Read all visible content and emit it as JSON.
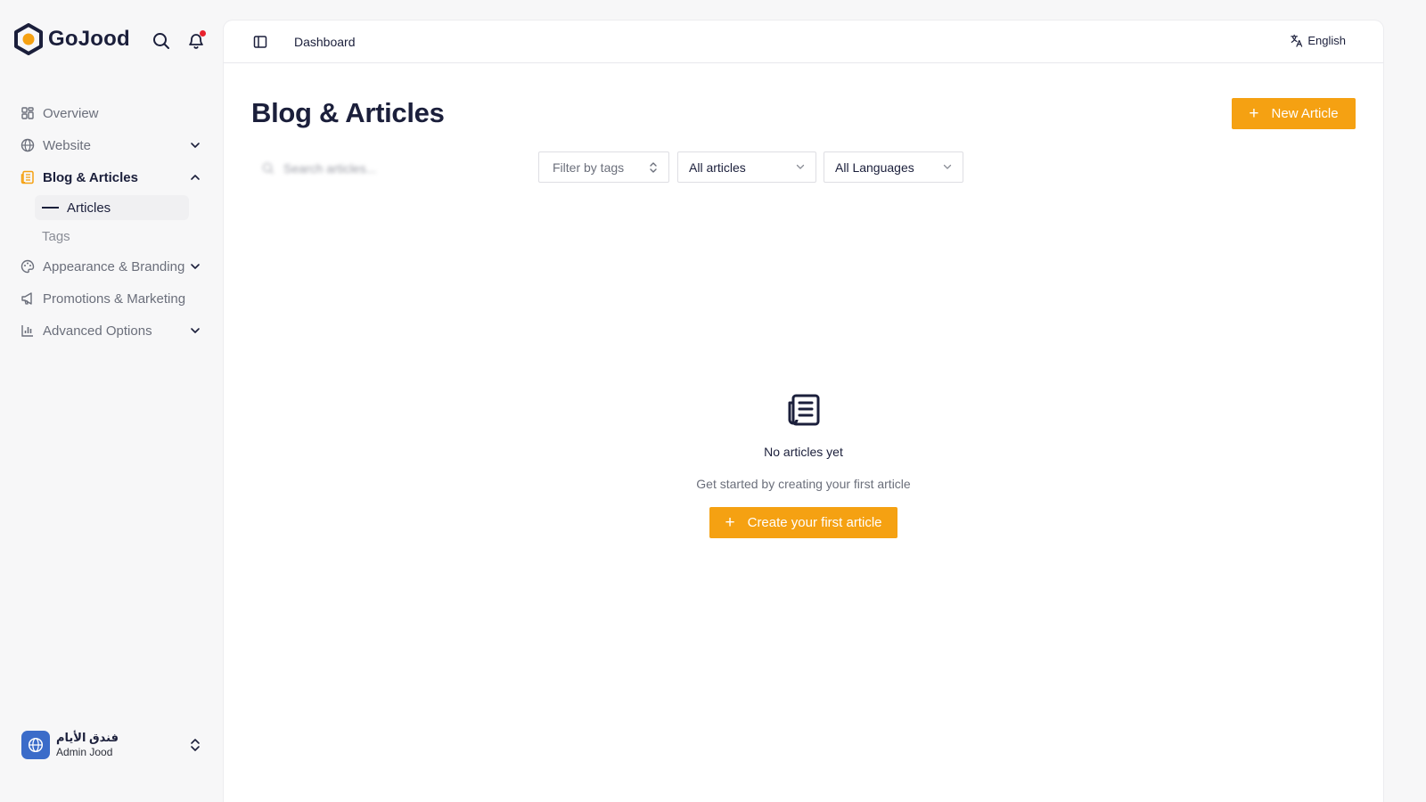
{
  "brand": {
    "name": "GoJood",
    "accent": "#f5a112",
    "navy": "#1b1f3b"
  },
  "sidebar": {
    "items": [
      {
        "label": "Overview",
        "icon": "grid-icon"
      },
      {
        "label": "Website",
        "icon": "globe-icon"
      },
      {
        "label": "Blog & Articles",
        "icon": "newspaper-icon"
      },
      {
        "label": "Appearance & Branding",
        "icon": "palette-icon"
      },
      {
        "label": "Promotions & Marketing",
        "icon": "megaphone-icon"
      },
      {
        "label": "Advanced Options",
        "icon": "bar-chart-icon"
      }
    ],
    "subitems": [
      {
        "label": "Articles"
      },
      {
        "label": "Tags"
      }
    ]
  },
  "account": {
    "title": "فندق الأيام",
    "subtitle": "Admin Jood"
  },
  "topbar": {
    "breadcrumb": "Dashboard",
    "language": "English"
  },
  "page": {
    "title": "Blog & Articles",
    "new_button": "New Article",
    "search_placeholder": "Search articles...",
    "filters": {
      "tags": "Filter by tags",
      "status": "All articles",
      "language": "All Languages"
    }
  },
  "empty_state": {
    "title": "No articles yet",
    "subtitle": "Get started by creating your first article",
    "button": "Create your first article"
  }
}
